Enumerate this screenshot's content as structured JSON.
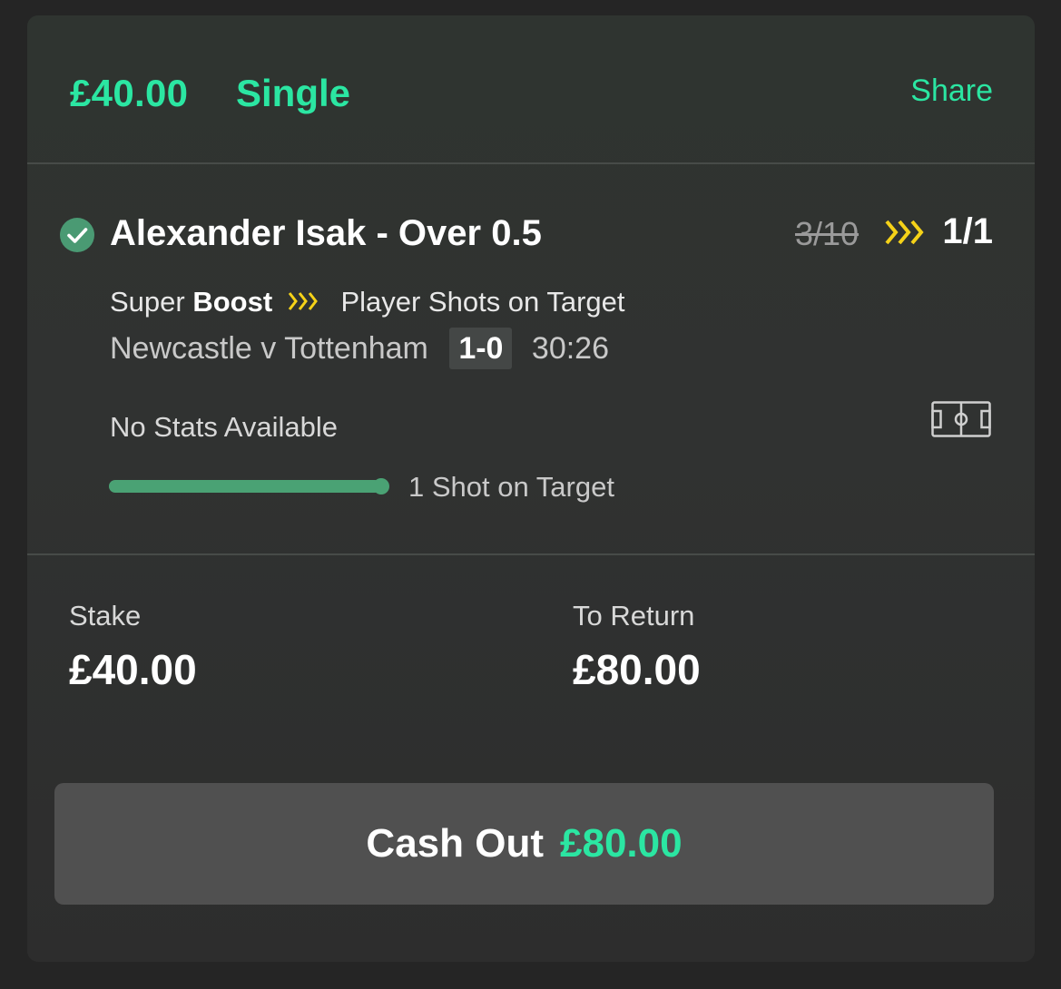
{
  "header": {
    "amount": "£40.00",
    "bet_type": "Single",
    "share_label": "Share"
  },
  "selection": {
    "name": "Alexander Isak - Over 0.5",
    "status_icon": "check-circle-icon",
    "odds_old": "3/10",
    "odds_new": "1/1",
    "boost_prefix": "Super",
    "boost_word": "Boost",
    "market": "Player Shots on Target",
    "event": "Newcastle v Tottenham",
    "score": "1-0",
    "clock": "30:26",
    "stats_text": "No Stats Available",
    "progress_fraction": 1.0,
    "progress_label": "1 Shot on Target"
  },
  "summary": {
    "stake_label": "Stake",
    "stake_value": "£40.00",
    "return_label": "To Return",
    "return_value": "£80.00"
  },
  "cashout": {
    "label": "Cash Out",
    "amount": "£80.00"
  },
  "colors": {
    "accent_green": "#2be6a2",
    "boost_yellow": "#f5d218",
    "progress_green": "#4aa274",
    "check_green": "#4a9a73"
  }
}
